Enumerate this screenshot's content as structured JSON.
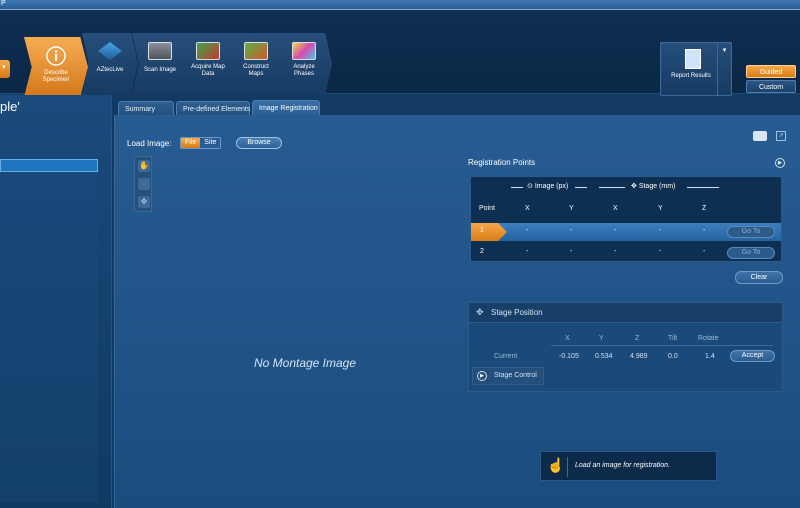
{
  "app": {
    "title_fragment": "P"
  },
  "nav_steps": [
    {
      "label": "Describe Specimen",
      "active": true
    },
    {
      "label": "AZtecLive",
      "active": false
    },
    {
      "label": "Scan Image",
      "active": false
    },
    {
      "label": "Acquire Map Data",
      "active": false
    },
    {
      "label": "Construct Maps",
      "active": false
    },
    {
      "label": "Analyze Phases",
      "active": false
    }
  ],
  "report": {
    "label": "Report Results"
  },
  "modes": {
    "guided": "Guided",
    "custom": "Custom"
  },
  "left_panel": {
    "title_fragment": "ple'"
  },
  "tabs": [
    {
      "label": "Summary",
      "active": false
    },
    {
      "label": "Pre-defined Elements",
      "active": false
    },
    {
      "label": "Image Registration",
      "active": true
    }
  ],
  "load_image": {
    "label": "Load Image:",
    "options": [
      "File",
      "Site"
    ],
    "selected": "File",
    "browse_label": "Browse"
  },
  "image_view": {
    "empty_text": "No Montage Image"
  },
  "registration_points": {
    "title": "Registration Points",
    "image_group": "Image (px)",
    "stage_group": "Stage (mm)",
    "columns": [
      "Point",
      "X",
      "Y",
      "X",
      "Y",
      "Z"
    ],
    "rows": [
      {
        "point": "1",
        "img_x": "-",
        "img_y": "-",
        "stage_x": "-",
        "stage_y": "-",
        "stage_z": "-",
        "goto": "Go To",
        "selected": true
      },
      {
        "point": "2",
        "img_x": "-",
        "img_y": "-",
        "stage_x": "-",
        "stage_y": "-",
        "stage_z": "-",
        "goto": "Go To",
        "selected": false
      }
    ],
    "clear_label": "Clear"
  },
  "stage_position": {
    "title": "Stage Position",
    "columns": [
      "X",
      "Y",
      "Z",
      "Tilt",
      "Rotate"
    ],
    "row_label": "Current",
    "values": [
      "-0.105",
      "0.534",
      "4.989",
      "0.0",
      "1.4"
    ],
    "accept_label": "Accept",
    "stage_control_label": "Stage Control"
  },
  "tooltip": {
    "text": "Load an image for registration."
  },
  "colors": {
    "accent_orange": "#e8922f",
    "panel_blue": "#1b4c7e",
    "dark_blue": "#0d2f52"
  }
}
